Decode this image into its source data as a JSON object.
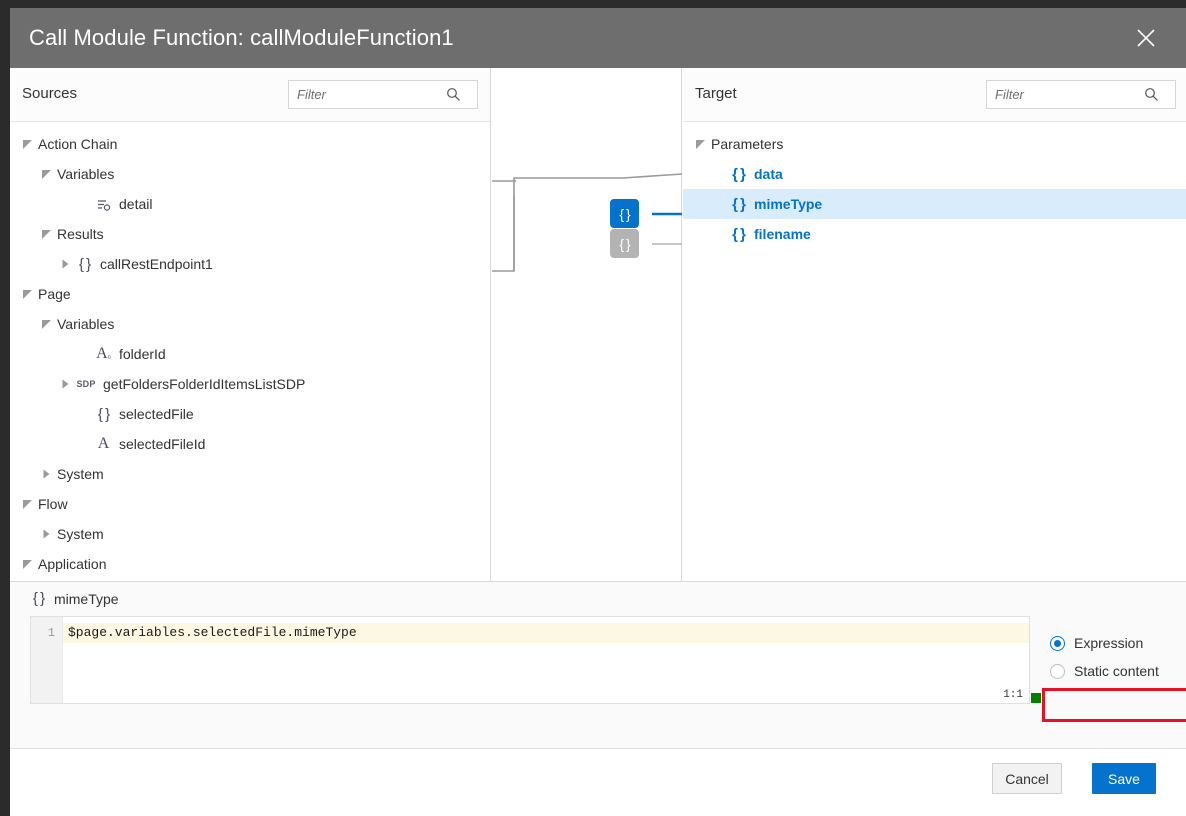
{
  "window": {
    "title": "Call Module Function: callModuleFunction1",
    "close_icon": "close-icon"
  },
  "sources": {
    "title": "Sources",
    "filter": {
      "value": "",
      "placeholder": "Filter",
      "icon": "search-icon"
    },
    "tree": [
      {
        "label": "Action Chain",
        "icon": "none",
        "indent": 0,
        "twist": "expanded"
      },
      {
        "label": "Variables",
        "icon": "none",
        "indent": 1,
        "twist": "expanded"
      },
      {
        "label": "detail",
        "icon": "detail-icon",
        "indent": 3,
        "twist": "none"
      },
      {
        "label": "Results",
        "icon": "none",
        "indent": 1,
        "twist": "expanded"
      },
      {
        "label": "callRestEndpoint1",
        "icon": "braces",
        "indent": 2,
        "twist": "collapsed"
      },
      {
        "label": "Page",
        "icon": "none",
        "indent": 0,
        "twist": "expanded"
      },
      {
        "label": "Variables",
        "icon": "none",
        "indent": 1,
        "twist": "expanded"
      },
      {
        "label": "folderId",
        "icon": "string-var",
        "indent": 3,
        "twist": "none"
      },
      {
        "label": "getFoldersFolderIdItemsListSDP",
        "icon": "sdp",
        "indent": 2,
        "twist": "collapsed"
      },
      {
        "label": "selectedFile",
        "icon": "braces",
        "indent": 3,
        "twist": "none"
      },
      {
        "label": "selectedFileId",
        "icon": "string",
        "indent": 3,
        "twist": "none"
      },
      {
        "label": "System",
        "icon": "none",
        "indent": 1,
        "twist": "collapsed"
      },
      {
        "label": "Flow",
        "icon": "none",
        "indent": 0,
        "twist": "expanded"
      },
      {
        "label": "System",
        "icon": "none",
        "indent": 1,
        "twist": "collapsed"
      },
      {
        "label": "Application",
        "icon": "none",
        "indent": 0,
        "twist": "expanded"
      }
    ]
  },
  "mapping": {
    "badges": [
      {
        "icon": "braces",
        "state": "active",
        "name": "mapping-badge-mimetype"
      },
      {
        "icon": "braces",
        "state": "idle",
        "name": "mapping-badge-filename"
      }
    ]
  },
  "target": {
    "title": "Target",
    "filter": {
      "value": "",
      "placeholder": "Filter",
      "icon": "search-icon"
    },
    "tree": [
      {
        "label": "Parameters",
        "icon": "none",
        "indent": 0,
        "twist": "expanded",
        "param": false,
        "selected": false
      },
      {
        "label": "data",
        "icon": "braces",
        "indent": 1,
        "twist": "none",
        "param": true,
        "selected": false
      },
      {
        "label": "mimeType",
        "icon": "braces",
        "indent": 1,
        "twist": "none",
        "param": true,
        "selected": true
      },
      {
        "label": "filename",
        "icon": "braces",
        "indent": 1,
        "twist": "none",
        "param": true,
        "selected": false
      }
    ]
  },
  "expression": {
    "header_label": "mimeType",
    "header_icon": "braces",
    "line_number": "1",
    "code": "$page.variables.selectedFile.mimeType",
    "caret_position": "1:1",
    "valid_indicator_color": "#008000",
    "mode_options": [
      {
        "label": "Expression",
        "selected": true
      },
      {
        "label": "Static content",
        "selected": false
      }
    ],
    "highlight_color": "#e81123"
  },
  "footer": {
    "cancel_label": "Cancel",
    "save_label": "Save"
  }
}
